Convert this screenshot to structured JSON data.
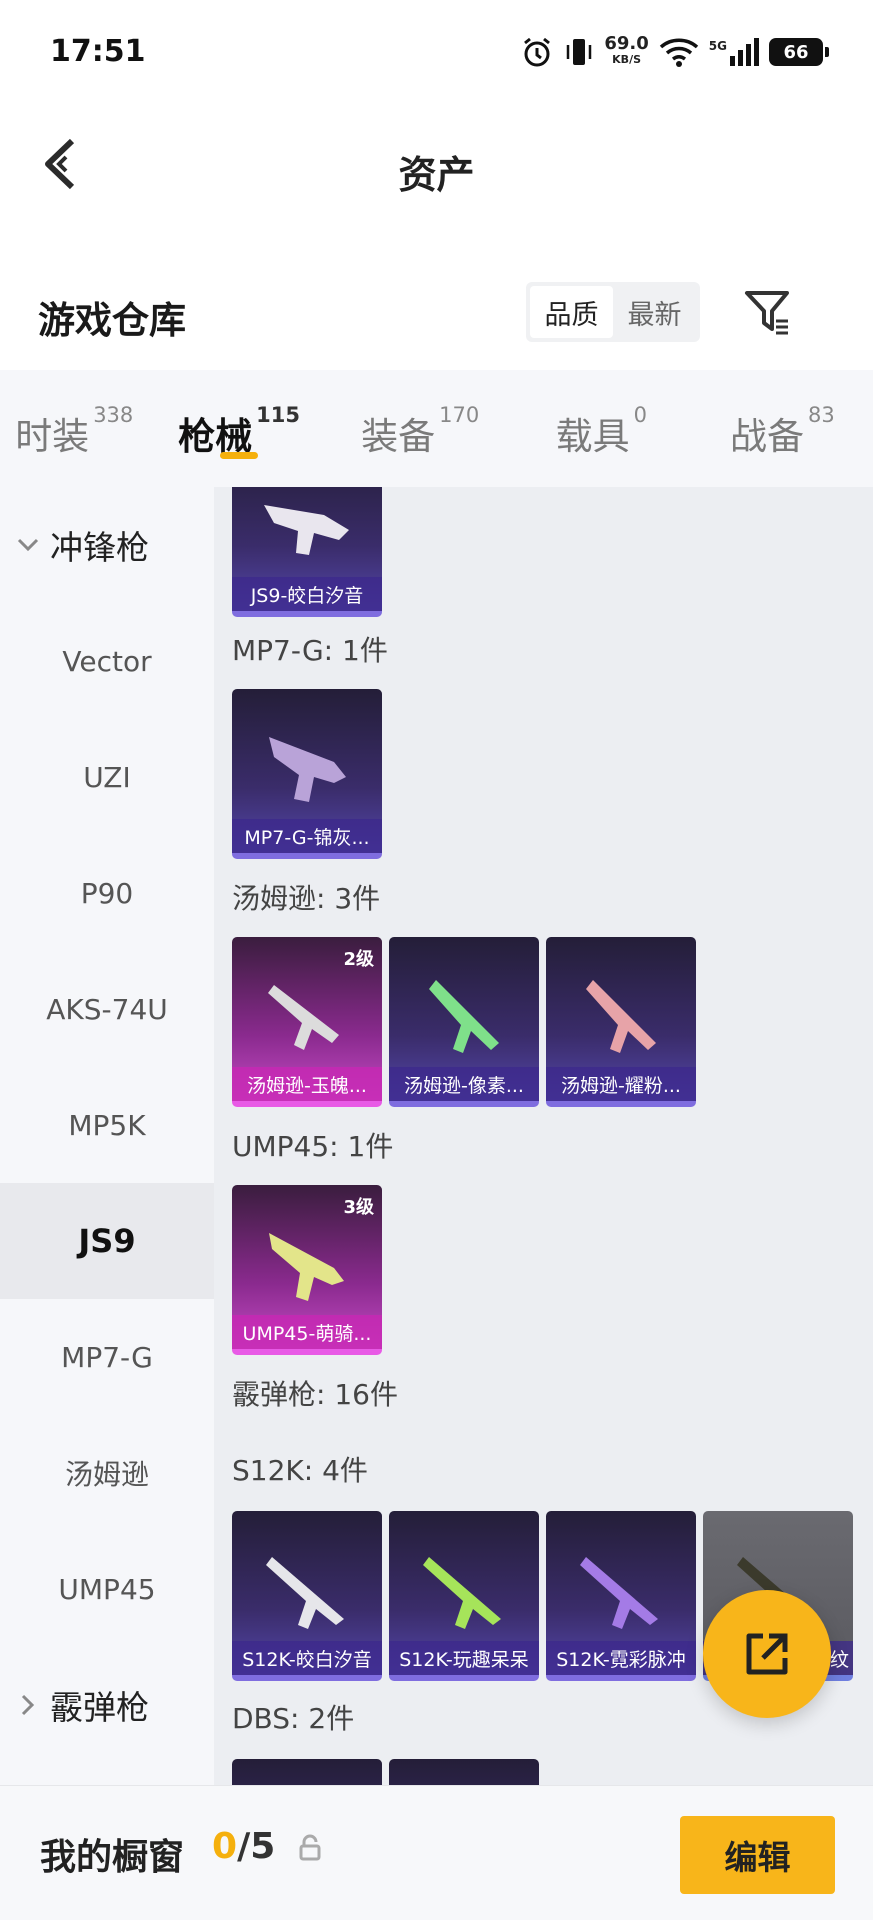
{
  "status_bar": {
    "time": "17:51",
    "net_speed": "69.0",
    "net_unit": "KB/S",
    "signal_label": "5G",
    "battery": "66"
  },
  "header": {
    "title": "资产"
  },
  "warehouse": {
    "title": "游戏仓库",
    "sort_quality": "品质",
    "sort_latest": "最新"
  },
  "tabs": [
    {
      "label": "时装",
      "count": "338"
    },
    {
      "label": "枪械",
      "count": "115"
    },
    {
      "label": "装备",
      "count": "170"
    },
    {
      "label": "载具",
      "count": "0"
    },
    {
      "label": "战备",
      "count": "83"
    }
  ],
  "sidebar": {
    "group_expanded": "冲锋枪",
    "items": [
      "Vector",
      "UZI",
      "P90",
      "AKS-74U",
      "MP5K",
      "JS9",
      "MP7-G",
      "汤姆逊",
      "UMP45"
    ],
    "active": "JS9",
    "group_collapsed": "霰弹枪"
  },
  "content": {
    "js9_card": "JS9-皎白汐音",
    "mp7_label": "MP7-G: 1件",
    "mp7_card": "MP7-G-锦灰...",
    "thompson_label": "汤姆逊: 3件",
    "thompson_cards": [
      {
        "name": "汤姆逊-玉魄...",
        "level": "2级"
      },
      {
        "name": "汤姆逊-像素..."
      },
      {
        "name": "汤姆逊-耀粉..."
      }
    ],
    "ump_label": "UMP45: 1件",
    "ump_card": {
      "name": "UMP45-萌骑...",
      "level": "3级"
    },
    "shotgun_label": "霰弹枪: 16件",
    "s12k_label": "S12K: 4件",
    "s12k_cards": [
      "S12K-皎白汐音",
      "S12K-玩趣呆呆",
      "S12K-霓彩脉冲",
      "纹"
    ],
    "dbs_label": "DBS: 2件"
  },
  "bottom": {
    "label": "我的橱窗",
    "current": "0",
    "separator": "/",
    "total": "5",
    "edit": "编辑"
  },
  "colors": {
    "accent": "#f5b00d",
    "card_purple": "#3a2c6a",
    "card_pink": "#8a2a8e"
  }
}
